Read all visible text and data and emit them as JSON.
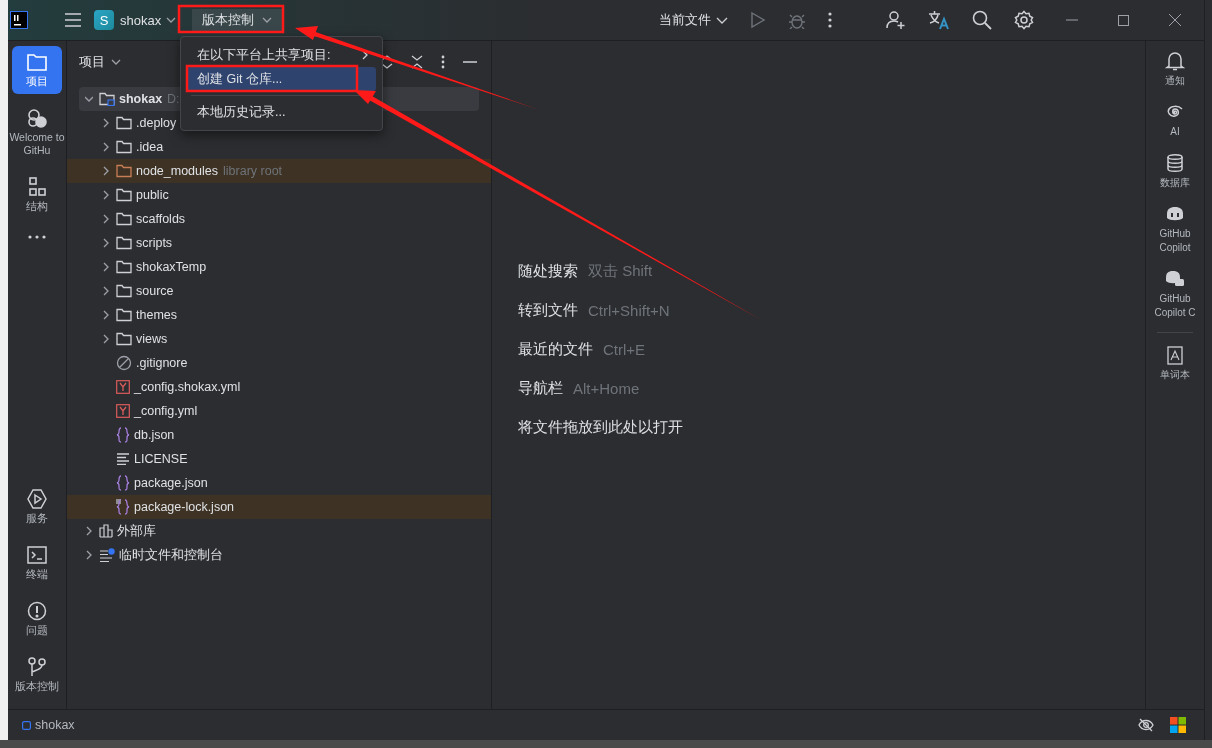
{
  "title_bar": {
    "project_initial": "S",
    "project_name": "shokax",
    "vcs_menu": "版本控制",
    "run_config": "当前文件"
  },
  "dropdown_menu": {
    "items": [
      {
        "label": "在以下平台上共享项目:",
        "kind": "submenu",
        "selected": false
      },
      {
        "label": "创建 Git 仓库...",
        "kind": "action",
        "selected": true
      },
      {
        "label": "本地历史记录...",
        "kind": "action",
        "selected": false,
        "separator_before": true
      }
    ]
  },
  "left_toolbar": {
    "top": [
      {
        "label": "项目",
        "selected": true
      },
      {
        "label": "Welcome to GitHu",
        "selected": false
      },
      {
        "label": "结构",
        "selected": false
      }
    ],
    "bottom": [
      {
        "label": "服务",
        "selected": false
      },
      {
        "label": "终端",
        "selected": false
      },
      {
        "label": "问题",
        "selected": false
      },
      {
        "label": "版本控制",
        "selected": false
      }
    ]
  },
  "project_panel": {
    "title": "项目",
    "tree": [
      {
        "name": "shokax",
        "hint": "D:",
        "kind": "folder",
        "expanded": true,
        "selected": true,
        "excluded": false,
        "children": [
          {
            "name": ".deploy",
            "kind": "folder",
            "expanded": false,
            "selected": false,
            "excluded": false
          },
          {
            "name": ".idea",
            "kind": "folder",
            "expanded": false,
            "selected": false,
            "excluded": false
          },
          {
            "name": "node_modules",
            "hint": "library root",
            "kind": "folder",
            "expanded": false,
            "selected": false,
            "excluded": true
          },
          {
            "name": "public",
            "kind": "folder",
            "expanded": false,
            "selected": false,
            "excluded": false
          },
          {
            "name": "scaffolds",
            "kind": "folder",
            "expanded": false,
            "selected": false,
            "excluded": false
          },
          {
            "name": "scripts",
            "kind": "folder",
            "expanded": false,
            "selected": false,
            "excluded": false
          },
          {
            "name": "shokaxTemp",
            "kind": "folder",
            "expanded": false,
            "selected": false,
            "excluded": false
          },
          {
            "name": "source",
            "kind": "folder",
            "expanded": false,
            "selected": false,
            "excluded": false
          },
          {
            "name": "themes",
            "kind": "folder",
            "expanded": false,
            "selected": false,
            "excluded": false
          },
          {
            "name": "views",
            "kind": "folder",
            "expanded": false,
            "selected": false,
            "excluded": false
          },
          {
            "name": ".gitignore",
            "kind": "ignore",
            "selected": false,
            "excluded": false
          },
          {
            "name": "_config.shokax.yml",
            "kind": "yaml",
            "selected": false,
            "excluded": false
          },
          {
            "name": "_config.yml",
            "kind": "yaml",
            "selected": false,
            "excluded": false
          },
          {
            "name": "db.json",
            "kind": "json",
            "selected": false,
            "excluded": false
          },
          {
            "name": "LICENSE",
            "kind": "text",
            "selected": false,
            "excluded": false
          },
          {
            "name": "package.json",
            "kind": "json",
            "selected": false,
            "excluded": false
          },
          {
            "name": "package-lock.json",
            "kind": "json",
            "selected": false,
            "excluded": true
          }
        ]
      },
      {
        "name": "外部库",
        "kind": "library",
        "expanded": false,
        "selected": false,
        "excluded": false
      },
      {
        "name": "临时文件和控制台",
        "kind": "scratches",
        "expanded": false,
        "selected": false,
        "excluded": false
      }
    ]
  },
  "editor_hints": [
    {
      "action": "随处搜索",
      "shortcut": "双击 Shift"
    },
    {
      "action": "转到文件",
      "shortcut": "Ctrl+Shift+N"
    },
    {
      "action": "最近的文件",
      "shortcut": "Ctrl+E"
    },
    {
      "action": "导航栏",
      "shortcut": "Alt+Home"
    },
    {
      "action": "将文件拖放到此处以打开"
    }
  ],
  "right_toolbar": [
    {
      "label": "通知"
    },
    {
      "label": "AI"
    },
    {
      "label": "数据库"
    },
    {
      "label": "GitHub Copilot"
    },
    {
      "label": "GitHub Copilot C"
    },
    {
      "label": "单词本",
      "separator_before": true
    }
  ],
  "status_bar": {
    "project": "shokax"
  }
}
